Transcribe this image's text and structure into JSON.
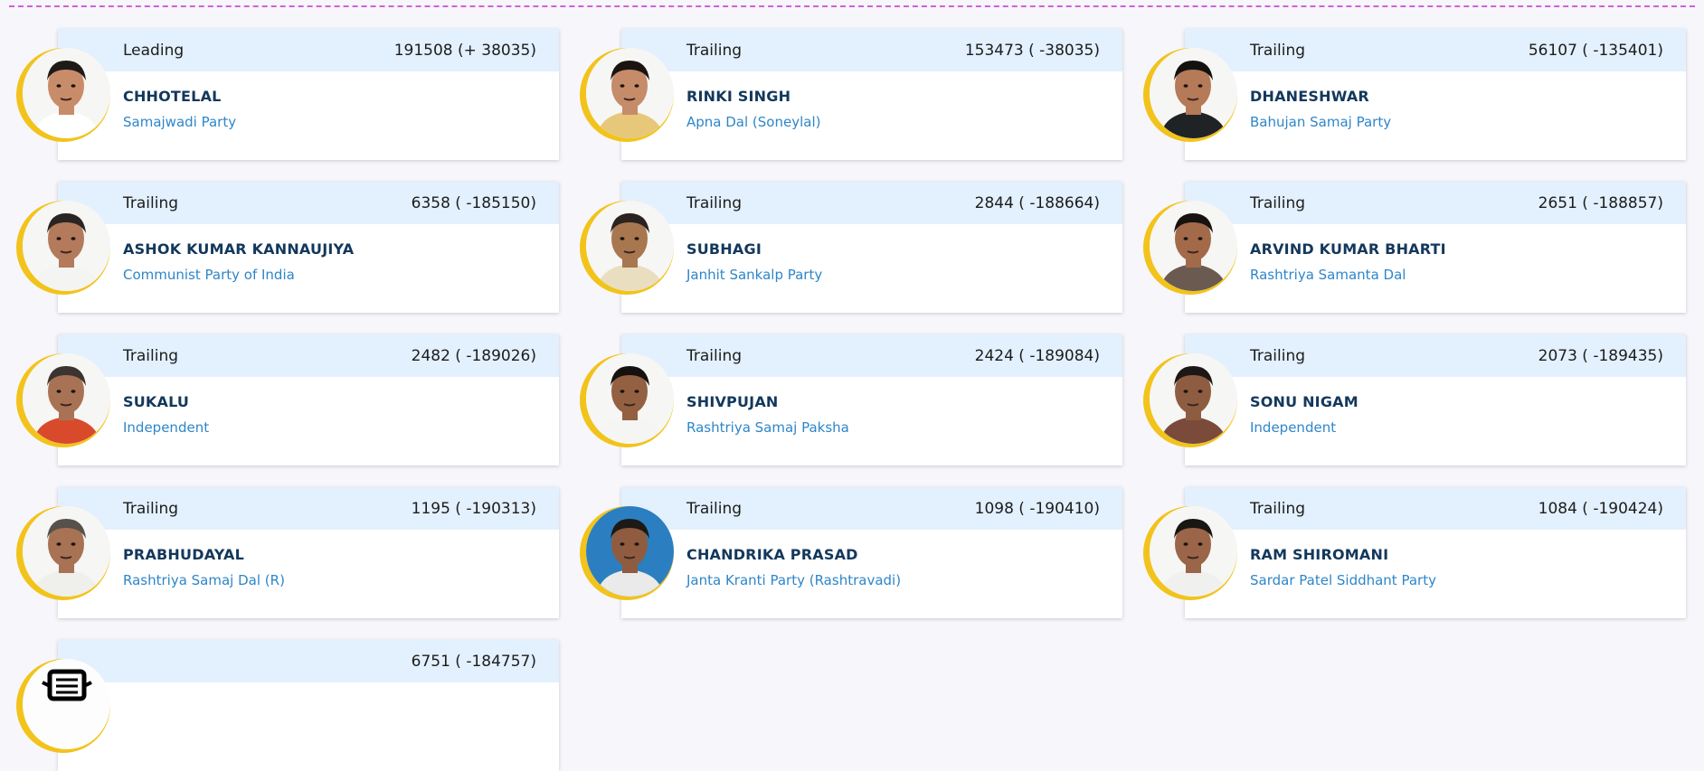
{
  "candidates": [
    {
      "status": "Leading",
      "votes": "191508 (+ 38035)",
      "name": "CHHOTELAL",
      "party": "Samajwadi Party",
      "colors": {
        "skin": "#c98c6a",
        "hair": "#1e1a18",
        "shirt": "#ffffff"
      }
    },
    {
      "status": "Trailing",
      "votes": "153473 ( -38035)",
      "name": "RINKI SINGH",
      "party": "Apna Dal (Soneylal)",
      "colors": {
        "skin": "#c68b69",
        "hair": "#1b1512",
        "shirt": "#e7c77a"
      }
    },
    {
      "status": "Trailing",
      "votes": "56107 ( -135401)",
      "name": "DHANESHWAR",
      "party": "Bahujan Samaj Party",
      "colors": {
        "skin": "#b57a57",
        "hair": "#141210",
        "shirt": "#1f2326"
      }
    },
    {
      "status": "Trailing",
      "votes": "6358 ( -185150)",
      "name": "ASHOK KUMAR KANNAUJIYA",
      "party": "Communist Party of India",
      "colors": {
        "skin": "#b37a5c",
        "hair": "#2a2522",
        "shirt": "#f4f4f2"
      }
    },
    {
      "status": "Trailing",
      "votes": "2844 ( -188664)",
      "name": "SUBHAGI",
      "party": "Janhit Sankalp Party",
      "colors": {
        "skin": "#a8774f",
        "hair": "#2a2320",
        "shirt": "#e9dec0"
      }
    },
    {
      "status": "Trailing",
      "votes": "2651 ( -188857)",
      "name": "ARVIND KUMAR BHARTI",
      "party": "Rashtriya Samanta Dal",
      "colors": {
        "skin": "#a36a4a",
        "hair": "#161210",
        "shirt": "#6b5a50"
      }
    },
    {
      "status": "Trailing",
      "votes": "2482 ( -189026)",
      "name": "SUKALU",
      "party": "Independent",
      "colors": {
        "skin": "#a87354",
        "hair": "#3c3430",
        "shirt": "#d9492c"
      }
    },
    {
      "status": "Trailing",
      "votes": "2424 ( -189084)",
      "name": "SHIVPUJAN",
      "party": "Rashtriya Samaj Paksha",
      "colors": {
        "skin": "#946042",
        "hair": "#15110f",
        "shirt": "#f5f5f3"
      }
    },
    {
      "status": "Trailing",
      "votes": "2073 ( -189435)",
      "name": "SONU NIGAM",
      "party": "Independent",
      "colors": {
        "skin": "#8e5d41",
        "hair": "#1c1815",
        "shirt": "#7a4a3a"
      }
    },
    {
      "status": "Trailing",
      "votes": "1195 ( -190313)",
      "name": "PRABHUDAYAL",
      "party": "Rashtriya Samaj Dal (R)",
      "colors": {
        "skin": "#a77354",
        "hair": "#57504b",
        "shirt": "#efefeb"
      }
    },
    {
      "status": "Trailing",
      "votes": "1098 ( -190410)",
      "name": "CHANDRIKA PRASAD",
      "party": "Janta Kranti Party (Rashtravadi)",
      "colors": {
        "skin": "#8f5c3f",
        "hair": "#1d1917",
        "shirt": "#eaeaea",
        "bg": "#2b7fc0"
      }
    },
    {
      "status": "Trailing",
      "votes": "1084 ( -190424)",
      "name": "RAM SHIROMANI",
      "party": "Sardar Patel Siddhant Party",
      "colors": {
        "skin": "#9a6548",
        "hair": "#1a1613",
        "shirt": "#f0f0ee"
      }
    }
  ],
  "nota": {
    "status": "",
    "votes": "6751 ( -184757)",
    "icon": "nota-icon"
  }
}
